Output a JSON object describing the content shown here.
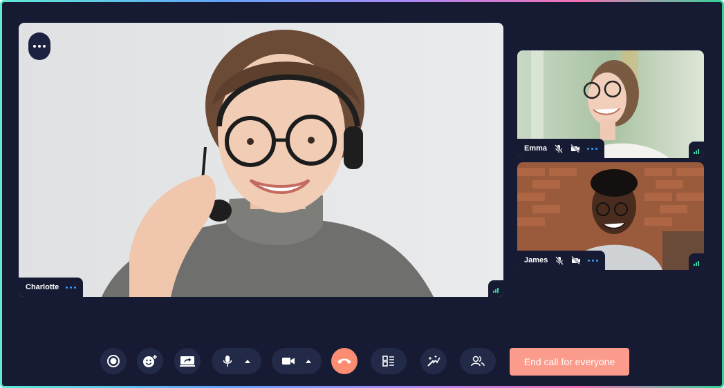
{
  "participants": {
    "main": {
      "name": "Charlotte"
    },
    "emma": {
      "name": "Emma"
    },
    "james": {
      "name": "James"
    }
  },
  "toolbar": {
    "end_for_everyone_label": "End call for everyone"
  },
  "icons": {
    "more": "more-dots-icon",
    "record": "record-icon",
    "reactions": "emoji-add-icon",
    "share_screen": "screen-share-icon",
    "microphone": "microphone-icon",
    "camera": "video-camera-icon",
    "end_call": "phone-hangup-icon",
    "layout": "layout-icon",
    "effects": "magic-wand-icon",
    "participants": "participants-icon",
    "muted_mic": "mic-off-icon",
    "camera_off": "video-off-icon",
    "signal": "signal-icon"
  },
  "colors": {
    "background": "#161a33",
    "button_bg": "#232a48",
    "end_call": "#fb8d73",
    "end_for_everyone": "#fb9b8c",
    "signal": "#38d39f",
    "dots_accent": "#3b9cff"
  }
}
